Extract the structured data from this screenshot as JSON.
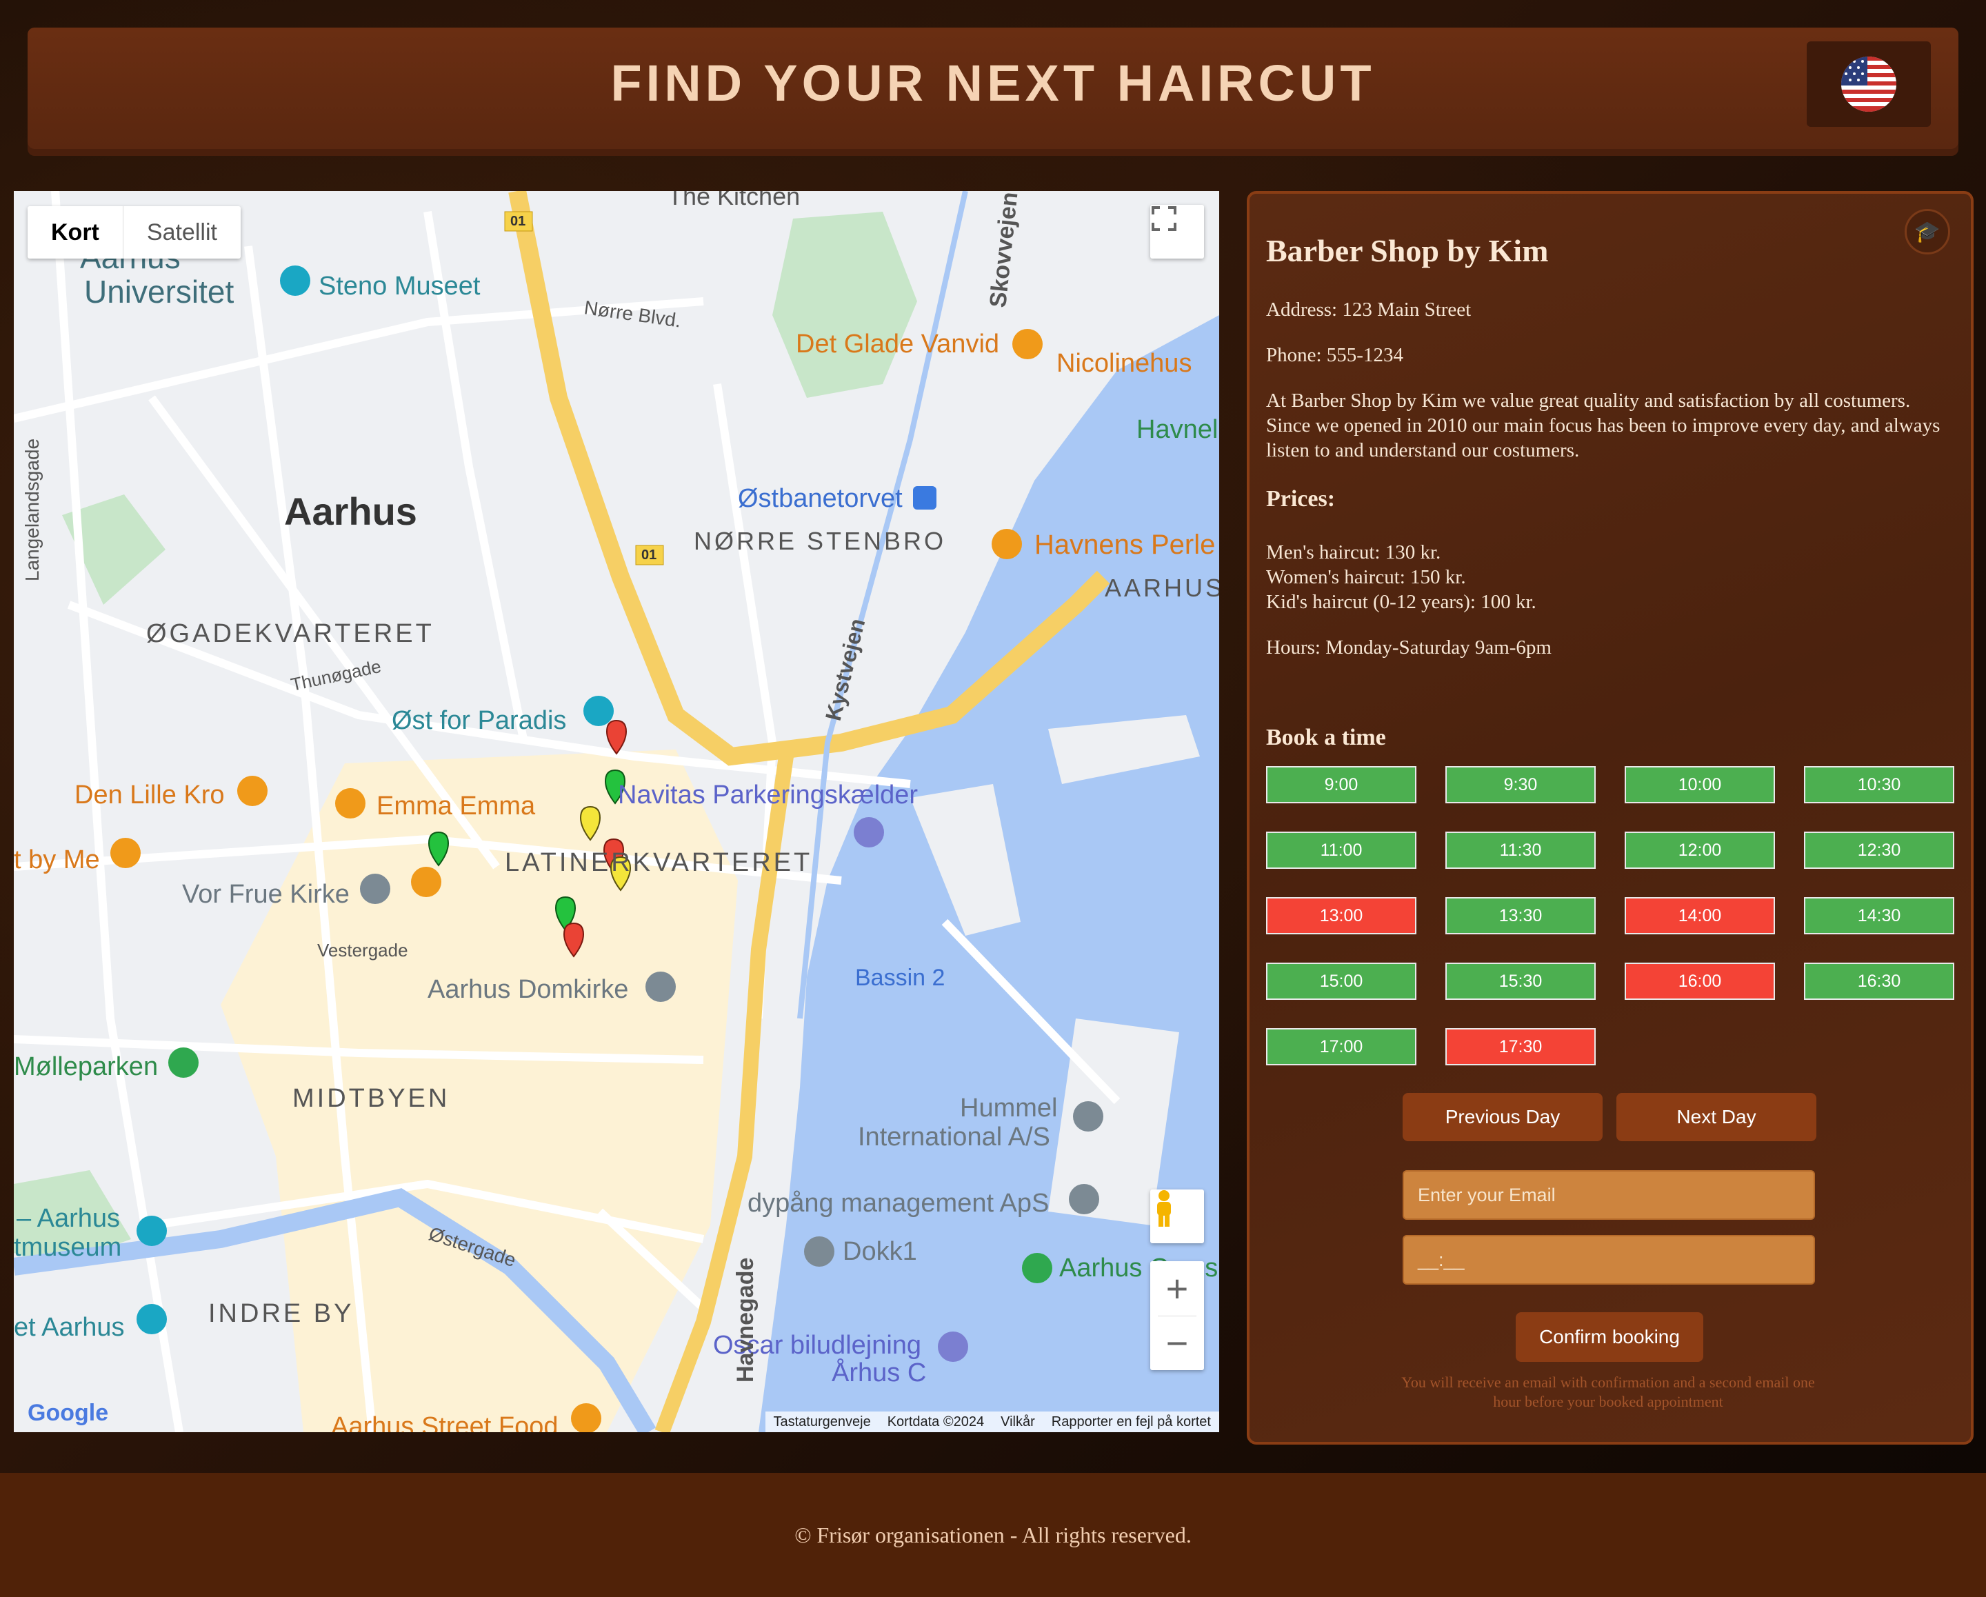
{
  "header": {
    "title": "FIND YOUR NEXT HAIRCUT",
    "language_flag": "us-flag-icon"
  },
  "map": {
    "map_type_tabs": [
      "Kort",
      "Satellit"
    ],
    "labels": {
      "aarhus_uni": "Aarhus Universitet",
      "aarhus_uni_l1": "Aarhus",
      "aarhus_uni_l2": "Universitet",
      "steno": "Steno Museet",
      "kitchen": "The Kitchen",
      "norre_blvd": "Nørre Blvd.",
      "glade_vanvid": "Det Glade Vanvid",
      "nicolinehus": "Nicolinehus",
      "havnel": "Havnel",
      "aarhus": "Aarhus",
      "ostbanetorvet": "Østbanetorvet",
      "norre_stenbro": "NØRRE STENBRO",
      "havnens_perle": "Havnens Perle",
      "aarhus_c": "AARHUS",
      "ogadekvarteret": "ØGADEKVARTERET",
      "thunogade": "Thunøgade",
      "ost_for_paradis": "Øst for Paradis",
      "navitas": "Navitas Parkeringskælder",
      "den_lille_kro": "Den Lille Kro",
      "emma_emma": "Emma Emma",
      "by_me": "t by Me",
      "latinerkvarteret": "LATINERKVARTERET",
      "vor_frue": "Vor Frue Kirke",
      "vestergade": "Vestergade",
      "domkirke": "Aarhus Domkirke",
      "bassin2": "Bassin 2",
      "molleparken": "Mølleparken",
      "midtbyen": "MIDTBYEN",
      "hummel": "Hummel International A/S",
      "hummel_l1": "Hummel",
      "hummel_l2": "International A/S",
      "dypang": "dypång management ApS",
      "aarhus_museum": "– Aarhus tmuseum",
      "aarhus_museum_l1": "– Aarhus",
      "aarhus_museum_l2": "tmuseum",
      "dokk1": "Dokk1",
      "aarhus_cross": "Aarhus Cross",
      "ostergade": "Østergade",
      "indre_by": "INDRE BY",
      "et_aarhus": "et Aarhus",
      "oscar": "Oscar biludlejning Århus C",
      "oscar_l1": "Oscar biludlejning",
      "oscar_l2": "Århus C",
      "street_food": "Aarhus Street Food",
      "havnegade": "Havnegade",
      "skovvejen": "Skovvejen",
      "kystvejen": "Kystvejen",
      "langelandsgade": "Langelandsgade",
      "route_01": "01"
    },
    "attribution": [
      "Tastaturgenveje",
      "Kortdata ©2024",
      "Vilkår",
      "Rapporter en fejl på kortet"
    ],
    "google": "Google"
  },
  "shop": {
    "name": "Barber Shop by Kim",
    "address": "Address: 123 Main Street",
    "phone": "Phone: 555-1234",
    "description": "At Barber Shop by Kim we value great quality and satisfaction by all costumers. Since we opened in 2010 our main focus has been to improve every day, and always listen to and understand our costumers.",
    "prices_title": "Prices:",
    "prices": [
      "Men's haircut: 130 kr.",
      "Women's haircut: 150 kr.",
      "Kid's haircut (0-12 years): 100 kr."
    ],
    "hours": "Hours: Monday-Saturday 9am-6pm"
  },
  "booking": {
    "title": "Book a time",
    "slots": [
      {
        "time": "9:00",
        "status": "free"
      },
      {
        "time": "9:30",
        "status": "free"
      },
      {
        "time": "10:00",
        "status": "free"
      },
      {
        "time": "10:30",
        "status": "free"
      },
      {
        "time": "11:00",
        "status": "free"
      },
      {
        "time": "11:30",
        "status": "free"
      },
      {
        "time": "12:00",
        "status": "free"
      },
      {
        "time": "12:30",
        "status": "free"
      },
      {
        "time": "13:00",
        "status": "busy"
      },
      {
        "time": "13:30",
        "status": "free"
      },
      {
        "time": "14:00",
        "status": "busy"
      },
      {
        "time": "14:30",
        "status": "free"
      },
      {
        "time": "15:00",
        "status": "free"
      },
      {
        "time": "15:30",
        "status": "free"
      },
      {
        "time": "16:00",
        "status": "busy"
      },
      {
        "time": "16:30",
        "status": "free"
      },
      {
        "time": "17:00",
        "status": "free"
      },
      {
        "time": "17:30",
        "status": "busy"
      }
    ],
    "prev_label": "Previous Day",
    "next_label": "Next Day",
    "email_placeholder": "Enter your Email",
    "time_placeholder": "__:__",
    "confirm_label": "Confirm booking",
    "note": "You will receive an email with confirmation and a second email one hour before your booked appointment"
  },
  "footer": {
    "text": "© Frisør organisationen - All rights reserved."
  },
  "colors": {
    "free": "#4caf50",
    "busy": "#f44336",
    "accent": "#8b3c14"
  }
}
